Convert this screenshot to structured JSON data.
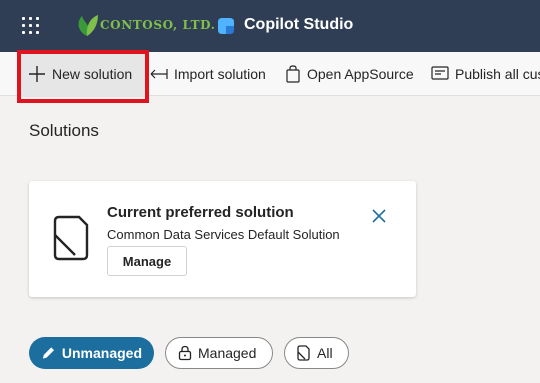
{
  "header": {
    "brand": "CONTOSO, LTD.",
    "product": "Copilot Studio",
    "waffle_icon": "waffle-icon",
    "logo_icon": "leaf-logo-icon",
    "product_icon": "copilot-studio-icon",
    "colors": {
      "bar": "#2f3e55",
      "brand": "#7fc04a"
    }
  },
  "commandbar": {
    "new_solution": "New solution",
    "import_solution": "Import solution",
    "open_appsource": "Open AppSource",
    "publish_all": "Publish all cus"
  },
  "page": {
    "title": "Solutions"
  },
  "card": {
    "title": "Current preferred solution",
    "subtitle": "Common Data Services Default Solution",
    "button": "Manage",
    "icon": "solution-icon",
    "close_icon": "close-icon"
  },
  "filters": [
    {
      "label": "Unmanaged",
      "selected": true,
      "icon": "pencil-icon"
    },
    {
      "label": "Managed",
      "selected": false,
      "icon": "lock-icon"
    },
    {
      "label": "All",
      "selected": false,
      "icon": "solution-icon"
    }
  ],
  "colors": {
    "accent": "#1b6e9e",
    "highlight": "#e0141e"
  }
}
